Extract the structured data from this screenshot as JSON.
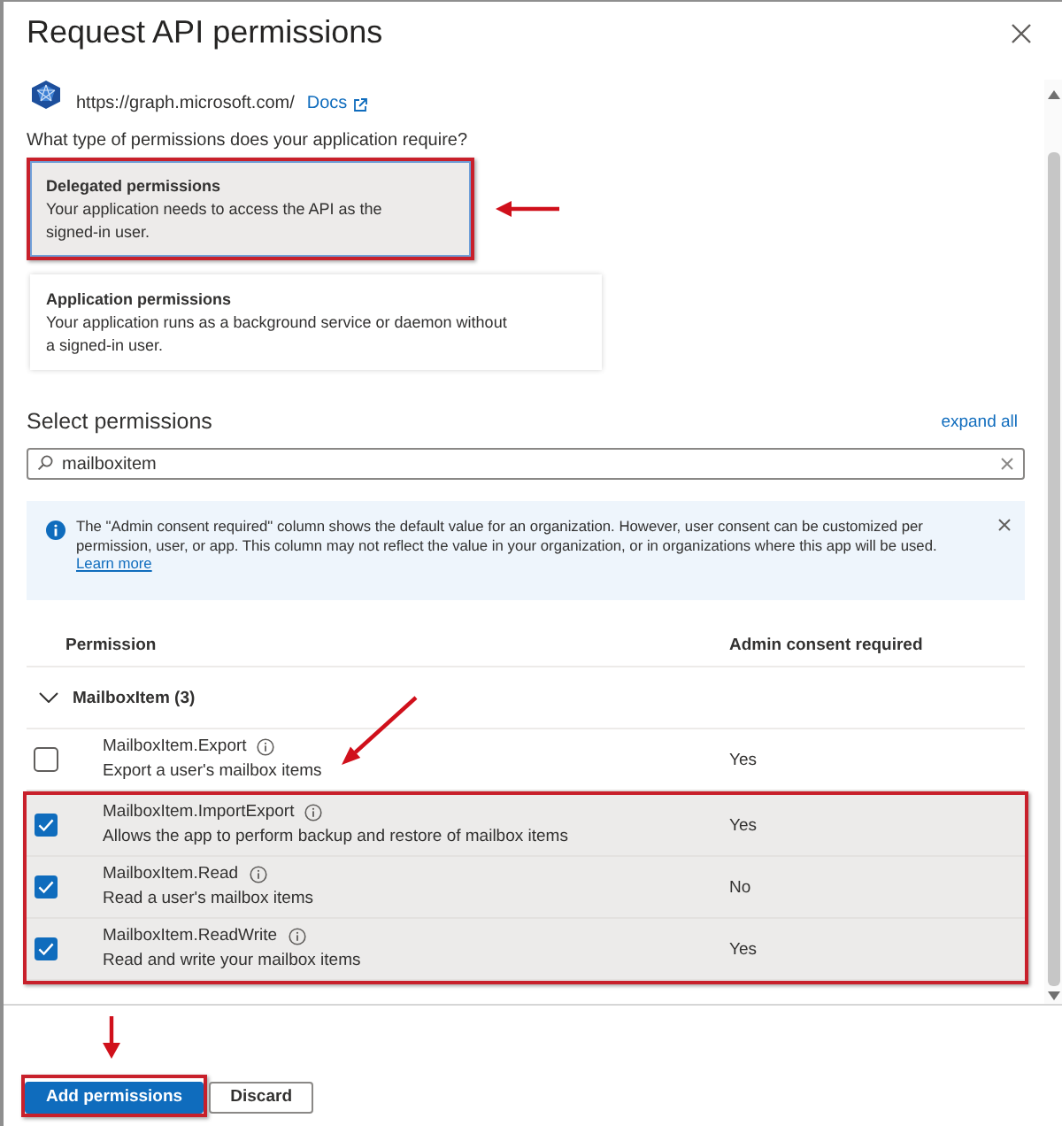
{
  "window": {
    "title": "Request API permissions"
  },
  "api": {
    "url": "https://graph.microsoft.com/",
    "docs_link": "Docs"
  },
  "question": "What type of permissions does your application require?",
  "permission_types": [
    {
      "title": "Delegated permissions",
      "description": "Your application needs to access the API as the signed-in user.",
      "selected": true,
      "highlighted": true,
      "arrow": true
    },
    {
      "title": "Application permissions",
      "description": "Your application runs as a background service or daemon without a signed-in user.",
      "selected": false,
      "highlighted": false,
      "arrow": false
    }
  ],
  "select_permissions": {
    "heading": "Select permissions",
    "expand_all": "expand all",
    "search": {
      "value": "mailboxitem"
    }
  },
  "info_bar": {
    "text": "The \"Admin consent required\" column shows the default value for an organization. However, user consent can be customized per permission, user, or app. This column may not reflect the value in your organization, or in organizations where this app will be used.",
    "link": "Learn more"
  },
  "table": {
    "columns": [
      "Permission",
      "Admin consent required"
    ],
    "groups": [
      {
        "name": "MailboxItem (3)",
        "expanded": true,
        "permissions": [
          {
            "name": "MailboxItem.Export",
            "description": "Export a user's mailbox items",
            "admin_consent": "Yes",
            "checked": false,
            "highlighted": false,
            "arrow": true
          },
          {
            "name": "MailboxItem.ImportExport",
            "description": "Allows the app to perform backup and restore of mailbox items",
            "admin_consent": "Yes",
            "checked": true,
            "highlighted": true,
            "arrow": false
          },
          {
            "name": "MailboxItem.Read",
            "description": "Read a user's mailbox items",
            "admin_consent": "No",
            "checked": true,
            "highlighted": true,
            "arrow": false
          },
          {
            "name": "MailboxItem.ReadWrite",
            "description": "Read and write your mailbox items",
            "admin_consent": "Yes",
            "checked": true,
            "highlighted": true,
            "arrow": false
          }
        ]
      }
    ]
  },
  "buttons": [
    {
      "label": "Add permissions",
      "kind": "primary",
      "highlighted": true,
      "arrow": true
    },
    {
      "label": "Discard",
      "kind": "secondary",
      "highlighted": false,
      "arrow": false
    }
  ]
}
